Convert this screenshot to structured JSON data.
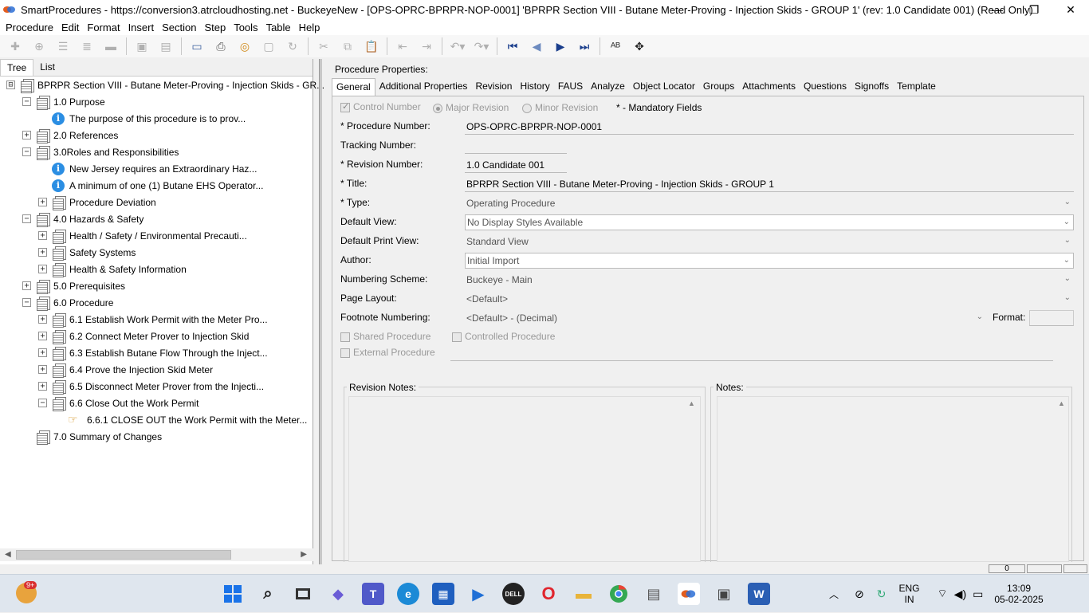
{
  "window": {
    "title": "SmartProcedures - https://conversion3.atrcloudhosting.net - BuckeyeNew - [OPS-OPRC-BPRPR-NOP-0001] 'BPRPR Section VIII - Butane Meter-Proving - Injection Skids - GROUP 1' (rev: 1.0 Candidate 001) (Read Only)",
    "minimize": "—",
    "restore": "❐",
    "close": "✕"
  },
  "menu": [
    "Procedure",
    "Edit",
    "Format",
    "Insert",
    "Section",
    "Step",
    "Tools",
    "Table",
    "Help"
  ],
  "left_tabs": [
    "Tree",
    "List"
  ],
  "tree": [
    {
      "level": 0,
      "expander": "⊟",
      "icon": "doc",
      "label": "BPRPR Section VIII - Butane Meter-Proving - Injection Skids - GR..."
    },
    {
      "level": 1,
      "expander": "−",
      "icon": "doc",
      "label": "1.0 Purpose"
    },
    {
      "level": 2,
      "expander": "",
      "icon": "info",
      "label": "The purpose of this procedure is to prov..."
    },
    {
      "level": 1,
      "expander": "+",
      "icon": "doc",
      "label": "2.0 References"
    },
    {
      "level": 1,
      "expander": "−",
      "icon": "doc",
      "label": "3.0Roles and Responsibilities"
    },
    {
      "level": 2,
      "expander": "",
      "icon": "info",
      "label": "New Jersey requires an Extraordinary Haz..."
    },
    {
      "level": 2,
      "expander": "",
      "icon": "info",
      "label": "A minimum of one (1) Butane EHS Operator..."
    },
    {
      "level": 2,
      "expander": "+",
      "icon": "doc",
      "label": "Procedure Deviation"
    },
    {
      "level": 1,
      "expander": "−",
      "icon": "doc",
      "label": "4.0 Hazards & Safety"
    },
    {
      "level": 2,
      "expander": "+",
      "icon": "doc",
      "label": "Health / Safety / Environmental Precauti..."
    },
    {
      "level": 2,
      "expander": "+",
      "icon": "doc",
      "label": "Safety Systems"
    },
    {
      "level": 2,
      "expander": "+",
      "icon": "doc",
      "label": "Health & Safety Information"
    },
    {
      "level": 1,
      "expander": "+",
      "icon": "doc",
      "label": "5.0 Prerequisites"
    },
    {
      "level": 1,
      "expander": "−",
      "icon": "doc",
      "label": "6.0 Procedure"
    },
    {
      "level": 2,
      "expander": "+",
      "icon": "doc",
      "label": "6.1 Establish Work Permit with the Meter Pro..."
    },
    {
      "level": 2,
      "expander": "+",
      "icon": "doc",
      "label": "6.2 Connect Meter Prover to Injection Skid"
    },
    {
      "level": 2,
      "expander": "+",
      "icon": "doc",
      "label": "6.3 Establish Butane Flow Through the Inject..."
    },
    {
      "level": 2,
      "expander": "+",
      "icon": "doc",
      "label": "6.4 Prove the Injection Skid Meter"
    },
    {
      "level": 2,
      "expander": "+",
      "icon": "doc",
      "label": "6.5 Disconnect Meter Prover from the Injecti..."
    },
    {
      "level": 2,
      "expander": "−",
      "icon": "doc",
      "label": "6.6 Close Out the Work Permit"
    },
    {
      "level": 3,
      "expander": "",
      "icon": "hand",
      "label": "6.6.1 CLOSE OUT the Work Permit with the Meter..."
    },
    {
      "level": 1,
      "expander": "",
      "icon": "doc",
      "label": "7.0 Summary of Changes"
    }
  ],
  "props": {
    "heading": "Procedure Properties:",
    "tabs": [
      "General",
      "Additional Properties",
      "Revision",
      "History",
      "FAUS",
      "Analyze",
      "Object Locator",
      "Groups",
      "Attachments",
      "Questions",
      "Signoffs",
      "Template"
    ],
    "control_number": "Control Number",
    "major_revision": "Major Revision",
    "minor_revision": "Minor Revision",
    "mandatory": "* - Mandatory Fields",
    "procedure_number_label": "* Procedure Number:",
    "procedure_number": "OPS-OPRC-BPRPR-NOP-0001",
    "tracking_number_label": "Tracking Number:",
    "tracking_number": "",
    "revision_number_label": "* Revision Number:",
    "revision_number": "1.0 Candidate 001",
    "title_label": "* Title:",
    "title": "BPRPR Section VIII - Butane Meter-Proving - Injection Skids - GROUP 1",
    "type_label": "* Type:",
    "type": "Operating Procedure",
    "default_view_label": "Default View:",
    "default_view": "No Display Styles Available",
    "default_print_view_label": "Default Print View:",
    "default_print_view": "Standard View",
    "author_label": "Author:",
    "author": "Initial Import",
    "numbering_scheme_label": "Numbering Scheme:",
    "numbering_scheme": "Buckeye - Main",
    "page_layout_label": "Page Layout:",
    "page_layout": "<Default>",
    "footnote_numbering_label": "Footnote Numbering:",
    "footnote_numbering": "<Default> - (Decimal)",
    "format_label": "Format:",
    "shared_procedure": "Shared Procedure",
    "controlled_procedure": "Controlled Procedure",
    "external_procedure": "External Procedure",
    "revision_notes": "Revision Notes:",
    "notes": "Notes:"
  },
  "status": {
    "counter": "0"
  },
  "taskbar": {
    "notification_badge": "9+",
    "lang_top": "ENG",
    "lang_bottom": "IN",
    "time": "13:09",
    "date": "05-02-2025"
  },
  "colors": {
    "accent": "#1a3e8c",
    "info": "#2b8ee3",
    "taskbar": "#dfe6ee"
  }
}
